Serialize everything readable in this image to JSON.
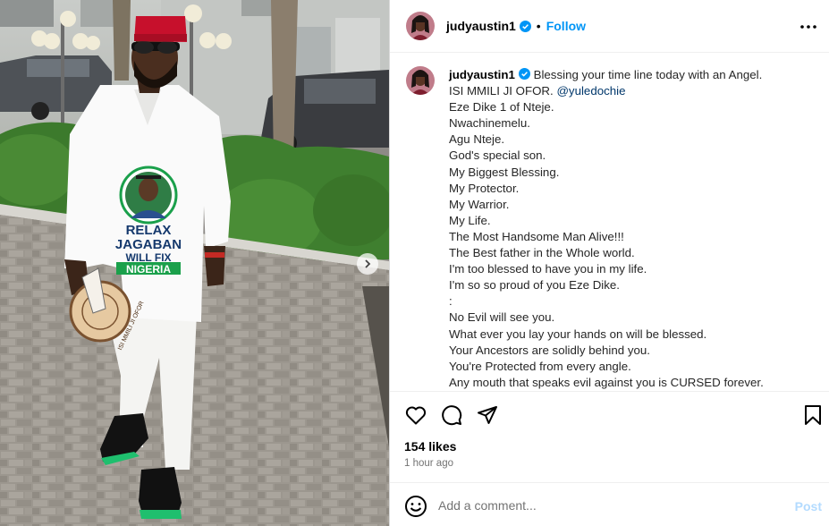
{
  "post": {
    "username": "judyaustin1",
    "follow_label": "Follow",
    "separator": "•",
    "caption_first": "Blessing your time line today with an Angel.",
    "caption_line2_text": "ISI MMILI JI OFOR.",
    "caption_mention": "@yuledochie",
    "caption_lines": [
      "Eze Dike 1 of Nteje.",
      "Nwachinemelu.",
      "Agu Nteje.",
      "God's special son.",
      "My Biggest Blessing.",
      "My Protector.",
      "My Warrior.",
      "My Life.",
      "The Most Handsome Man Alive!!!",
      "The Best father in the Whole world.",
      "I'm too blessed to have you in my life.",
      "I'm so so proud of you Eze Dike.",
      ":",
      "No Evil will see you.",
      "What ever you lay your hands on will be blessed.",
      "Your Ancestors are solidly behind you.",
      "You're Protected from every angle.",
      "Any mouth that speaks evil against you is CURSED forever."
    ],
    "likes": "154 likes",
    "timestamp": "1 hour ago",
    "comment_placeholder": "Add a comment...",
    "post_label": "Post"
  },
  "image": {
    "shirt_text": [
      "RELAX",
      "JAGABAN",
      "WILL FIX",
      "NIGERIA"
    ],
    "fan_text": "ISI MMILI JI OFOR"
  },
  "icons": {
    "verified": "verified-badge-icon",
    "more": "more-options-icon",
    "like": "heart-icon",
    "comment": "comment-icon",
    "share": "share-icon",
    "save": "bookmark-icon",
    "emoji": "emoji-icon",
    "next": "chevron-right-icon"
  },
  "colors": {
    "link_blue": "#0095f6",
    "verified_blue": "#0095f6",
    "mention": "#00376b",
    "muted": "#737373",
    "post_disabled": "#b3dbff"
  }
}
